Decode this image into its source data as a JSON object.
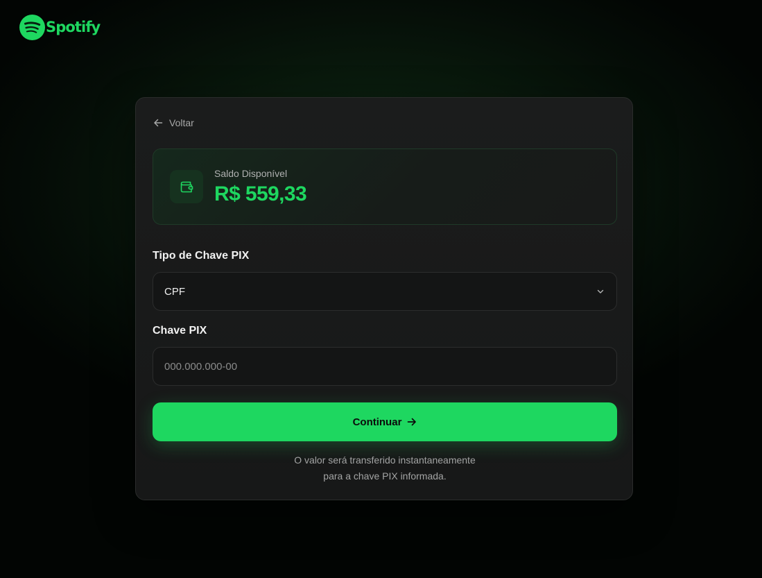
{
  "brand": {
    "name": "Spotify",
    "icon": "spotify-logo-icon",
    "color": "#1ed760"
  },
  "back": {
    "label": "Voltar",
    "icon": "arrow-left-icon"
  },
  "balance": {
    "label": "Saldo Disponível",
    "value": "R$ 559,33",
    "icon": "wallet-icon"
  },
  "pix_type": {
    "label": "Tipo de Chave PIX",
    "selected": "CPF",
    "icon": "chevron-down-icon"
  },
  "pix_key": {
    "label": "Chave PIX",
    "value": "",
    "placeholder": "000.000.000-00"
  },
  "continue": {
    "label": "Continuar",
    "icon": "arrow-right-icon",
    "color": "#1ed760"
  },
  "footnote": {
    "line1": "O valor será transferido instantaneamente",
    "line2": "para a chave PIX informada."
  }
}
